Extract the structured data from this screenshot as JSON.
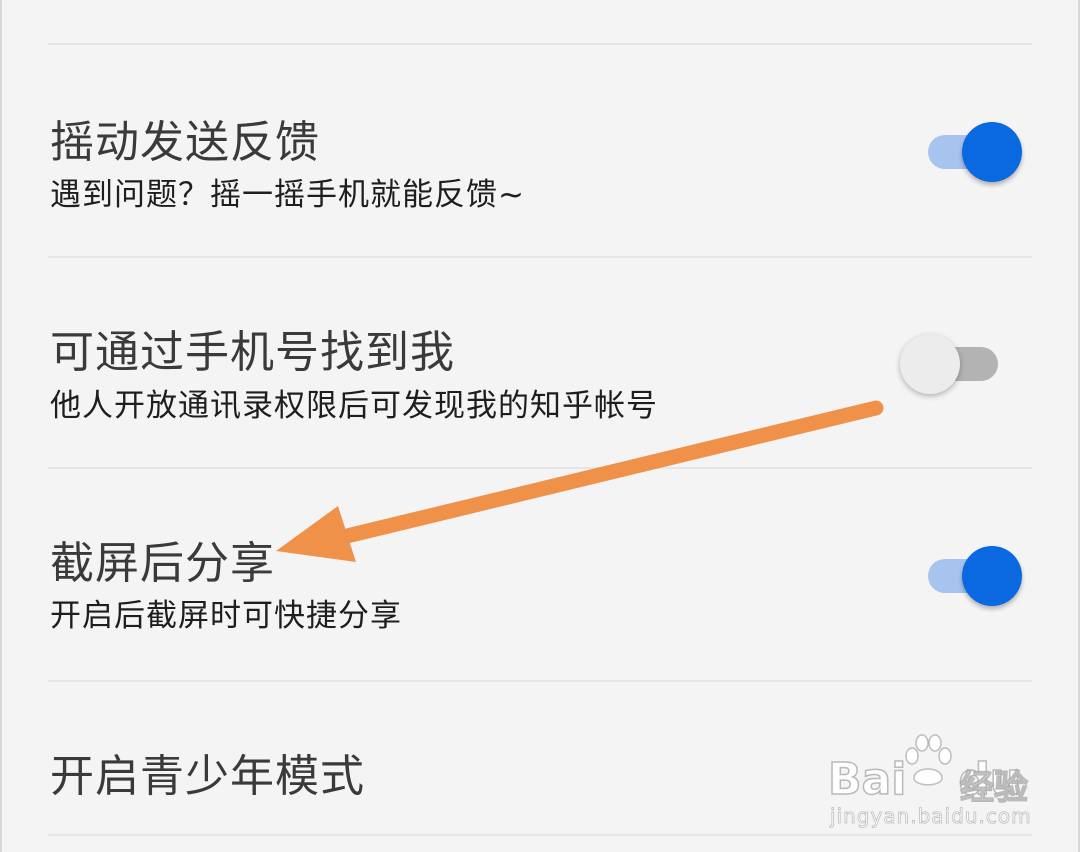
{
  "settings": {
    "items": [
      {
        "title": "摇动发送反馈",
        "subtitle": "遇到问题？摇一摇手机就能反馈~",
        "toggle": "on"
      },
      {
        "title": "可通过手机号找到我",
        "subtitle": "他人开放通讯录权限后可发现我的知乎帐号",
        "toggle": "off"
      },
      {
        "title": "截屏后分享",
        "subtitle": "开启后截屏时可快捷分享",
        "toggle": "on"
      },
      {
        "title": "开启青少年模式"
      }
    ]
  },
  "colors": {
    "toggle_on_thumb": "#0a68e0",
    "toggle_on_track": "#a7c4ee",
    "toggle_off_thumb": "#ececec",
    "toggle_off_track": "#b3b3b3",
    "annotation_arrow": "#f0914a"
  },
  "watermark": {
    "brand_left": "Bai",
    "brand_right": "du",
    "brand_cn": "经验",
    "url": "jingyan.baidu.com",
    "icon": "paw-icon"
  }
}
